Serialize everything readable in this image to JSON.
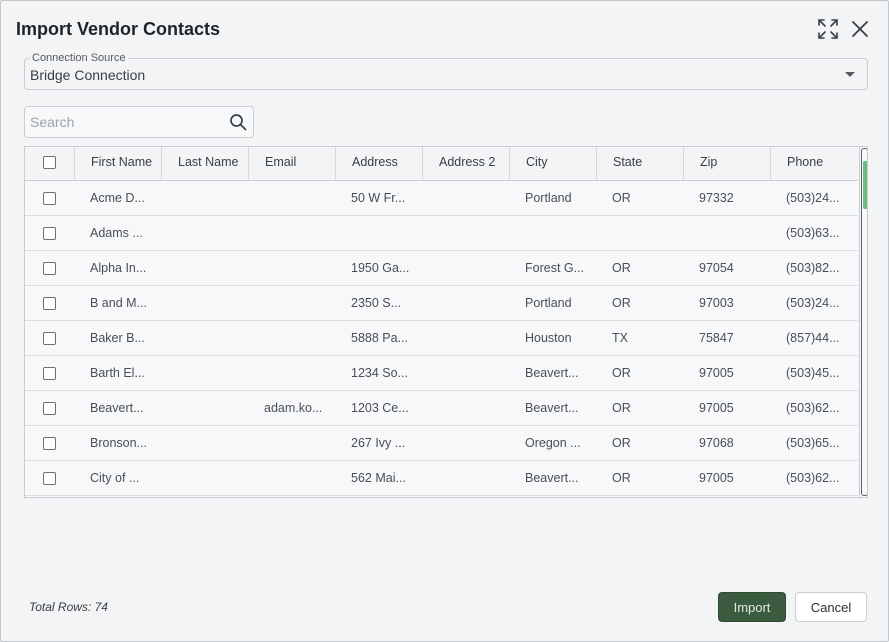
{
  "dialog": {
    "title": "Import Vendor Contacts",
    "icons": {
      "expand": "expand-icon",
      "close": "close-icon"
    }
  },
  "connection_source": {
    "label": "Connection Source",
    "value": "Bridge Connection"
  },
  "search": {
    "placeholder": "Search",
    "value": ""
  },
  "table": {
    "columns": [
      "First Name",
      "Last Name",
      "Email",
      "Address",
      "Address 2",
      "City",
      "State",
      "Zip",
      "Phone"
    ],
    "rows": [
      [
        "Acme D...",
        "",
        "",
        "50 W Fr...",
        "",
        "Portland",
        "OR",
        "97332",
        "(503)24..."
      ],
      [
        "Adams ...",
        "",
        "",
        "",
        "",
        "",
        "",
        "",
        "(503)63..."
      ],
      [
        "Alpha In...",
        "",
        "",
        "1950 Ga...",
        "",
        "Forest G...",
        "OR",
        "97054",
        "(503)82..."
      ],
      [
        "B and M...",
        "",
        "",
        "2350 S...",
        "",
        "Portland",
        "OR",
        "97003",
        "(503)24..."
      ],
      [
        "Baker B...",
        "",
        "",
        "5888 Pa...",
        "",
        "Houston",
        "TX",
        "75847",
        "(857)44..."
      ],
      [
        "Barth El...",
        "",
        "",
        "1234 So...",
        "",
        "Beavert...",
        "OR",
        "97005",
        "(503)45..."
      ],
      [
        "Beavert...",
        "",
        "adam.ko...",
        "1203 Ce...",
        "",
        "Beavert...",
        "OR",
        "97005",
        "(503)62..."
      ],
      [
        "Bronson...",
        "",
        "",
        "267 Ivy ...",
        "",
        "Oregon ...",
        "OR",
        "97068",
        "(503)65..."
      ],
      [
        "City of ...",
        "",
        "",
        "562 Mai...",
        "",
        "Beavert...",
        "OR",
        "97005",
        "(503)62..."
      ]
    ]
  },
  "footer": {
    "total_rows": "Total Rows: 74",
    "import_label": "Import",
    "cancel_label": "Cancel"
  },
  "colors": {
    "import_button": "#3b5b3e",
    "scroll_thumb": "#6dbb7f",
    "dialog_background": "#f3f4f5"
  }
}
